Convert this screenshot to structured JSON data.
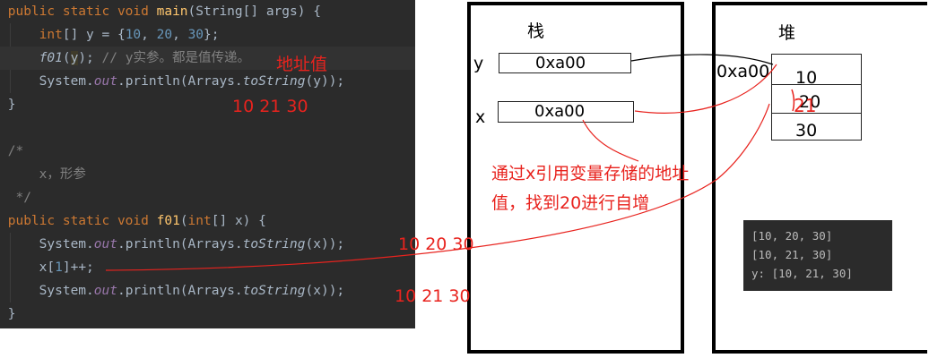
{
  "code": {
    "lines": [
      {
        "segments": [
          [
            "kw",
            "public static void "
          ],
          [
            "fn",
            "main"
          ],
          [
            "txt",
            "(String[] args) {"
          ]
        ]
      },
      {
        "segments": [
          [
            "txt",
            "    "
          ],
          [
            "kw",
            "int"
          ],
          [
            "txt",
            "[] y = {"
          ],
          [
            "num",
            "10"
          ],
          [
            "txt",
            ", "
          ],
          [
            "num",
            "20"
          ],
          [
            "txt",
            ", "
          ],
          [
            "num",
            "30"
          ],
          [
            "txt",
            "};"
          ]
        ]
      },
      {
        "segments": [
          [
            "txt",
            "    "
          ],
          [
            "sitalic",
            "f01"
          ],
          [
            "txt",
            "("
          ],
          [
            "caret",
            "y"
          ],
          [
            "txt",
            ");"
          ],
          [
            "cmt",
            " // y实参。都是值传递。"
          ]
        ]
      },
      {
        "segments": [
          [
            "txt",
            "    System."
          ],
          [
            "sfield",
            "out"
          ],
          [
            "txt",
            ".println(Arrays."
          ],
          [
            "sitalic",
            "toString"
          ],
          [
            "txt",
            "(y));"
          ]
        ]
      },
      {
        "segments": [
          [
            "txt",
            "}"
          ]
        ]
      },
      {
        "segments": []
      },
      {
        "segments": [
          [
            "cmt",
            "/*"
          ]
        ]
      },
      {
        "segments": [
          [
            "cmt",
            "    x，形参"
          ]
        ]
      },
      {
        "segments": [
          [
            "cmt",
            " */"
          ]
        ]
      },
      {
        "segments": [
          [
            "kw",
            "public static void "
          ],
          [
            "fn",
            "f01"
          ],
          [
            "txt",
            "("
          ],
          [
            "kw",
            "int"
          ],
          [
            "txt",
            "[] x) {"
          ]
        ]
      },
      {
        "segments": [
          [
            "txt",
            "    System."
          ],
          [
            "sfield",
            "out"
          ],
          [
            "txt",
            ".println(Arrays."
          ],
          [
            "sitalic",
            "toString"
          ],
          [
            "txt",
            "(x));"
          ]
        ]
      },
      {
        "segments": [
          [
            "txt",
            "    x["
          ],
          [
            "num",
            "1"
          ],
          [
            "txt",
            "]++;"
          ]
        ]
      },
      {
        "segments": [
          [
            "txt",
            "    System."
          ],
          [
            "sfield",
            "out"
          ],
          [
            "txt",
            ".println(Arrays."
          ],
          [
            "sitalic",
            "toString"
          ],
          [
            "txt",
            "(x));"
          ]
        ]
      },
      {
        "segments": [
          [
            "txt",
            "}"
          ]
        ]
      }
    ]
  },
  "annotations": {
    "address_value": "地址值",
    "result_main": "10 21 30",
    "result_before": "10 20 30",
    "result_after": "10 21 30",
    "explanation": "通过x引用变量存储的地址值，找到20进行自增",
    "heap_new_value": "21"
  },
  "stack": {
    "title": "栈",
    "y_label": "y",
    "y_value": "0xa00",
    "x_label": "x",
    "x_value": "0xa00"
  },
  "heap": {
    "title": "堆",
    "address": "0xa00",
    "values": [
      "10",
      "20",
      "30"
    ]
  },
  "console": {
    "lines": [
      "[10, 20, 30]",
      "[10, 21, 30]",
      "y: [10, 21, 30]"
    ]
  },
  "colors": {
    "annotation": "#e8231e",
    "editor_bg": "#2b2b2b",
    "keyword": "#cc7832",
    "function": "#ffc66d",
    "number": "#6897bb",
    "comment": "#808080"
  }
}
